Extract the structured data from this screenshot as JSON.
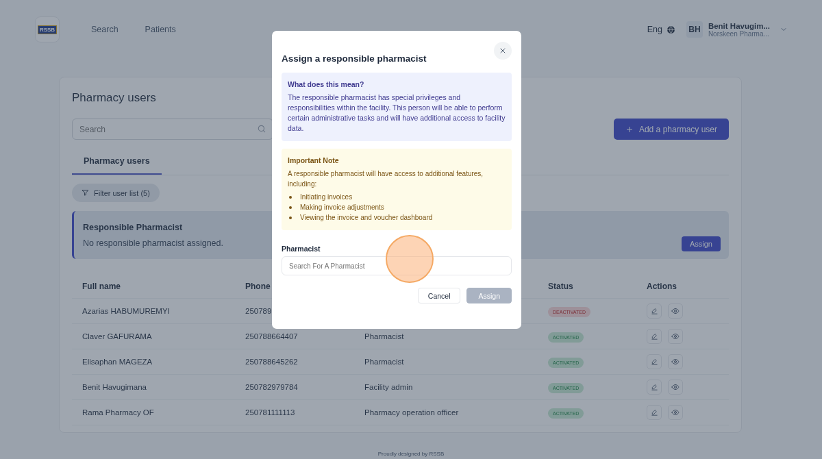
{
  "header": {
    "logo_text": "RSSB",
    "nav": [
      {
        "label": "Search",
        "selected": false
      },
      {
        "label": "Patients",
        "selected": false
      }
    ],
    "language": "Eng",
    "user": {
      "initials": "BH",
      "name": "Benit Havugim...",
      "facility": "Norskeen Pharma..."
    }
  },
  "page": {
    "title": "Pharmacy users",
    "search": {
      "placeholder": "Search"
    },
    "add_button": "Add a pharmacy user",
    "tabs": [
      {
        "label": "Pharmacy users",
        "selected": true
      }
    ],
    "filter": {
      "label": "Filter user list",
      "count": "(5)"
    },
    "responsible": {
      "title": "Responsible Pharmacist",
      "message": "No responsible pharmacist assigned.",
      "button": "Assign"
    },
    "table": {
      "columns": [
        "Full name",
        "Phone",
        "Status",
        "Actions"
      ],
      "rows": [
        {
          "full_name": "Azarias HABUMUREMYI",
          "phone": "250789",
          "status": "DEACTIVATED",
          "activated": false
        },
        {
          "full_name": "Claver GAFURAMA",
          "phone": "250788664407",
          "role": "Pharmacist",
          "status": "ACTIVATED",
          "activated": true
        },
        {
          "full_name": "Elisaphan MAGEZA",
          "phone": "250788645262",
          "role": "Pharmacist",
          "status": "ACTIVATED",
          "activated": true
        },
        {
          "full_name": "Benit Havugimana",
          "phone": "250782979784",
          "role": "Facility admin",
          "status": "ACTIVATED",
          "activated": true
        },
        {
          "full_name": "Rama Pharmacy OF",
          "phone": "250781111113",
          "role": "Pharmacy operation officer",
          "status": "ACTIVATED",
          "activated": true
        }
      ]
    }
  },
  "footer": "Proudly designed by RSSB",
  "dialog": {
    "title": "Assign a responsible pharmacist",
    "info": {
      "title": "What does this mean?",
      "text": "The responsible pharmacist has special privileges and responsibilities within the facility. This person will be able to perform certain administrative tasks and will have additional access to facility data."
    },
    "note": {
      "title": "Important Note",
      "text": "A responsible pharmacist will have access to additional features, including:",
      "items": [
        "Initiating invoices",
        "Making invoice adjustments",
        "Viewing the invoice and voucher dashboard"
      ]
    },
    "field": {
      "label": "Pharmacist",
      "placeholder": "Search For A Pharmacist"
    },
    "buttons": [
      {
        "label": "Cancel",
        "disabled": false
      },
      {
        "label": "Assign",
        "disabled": true
      }
    ]
  }
}
